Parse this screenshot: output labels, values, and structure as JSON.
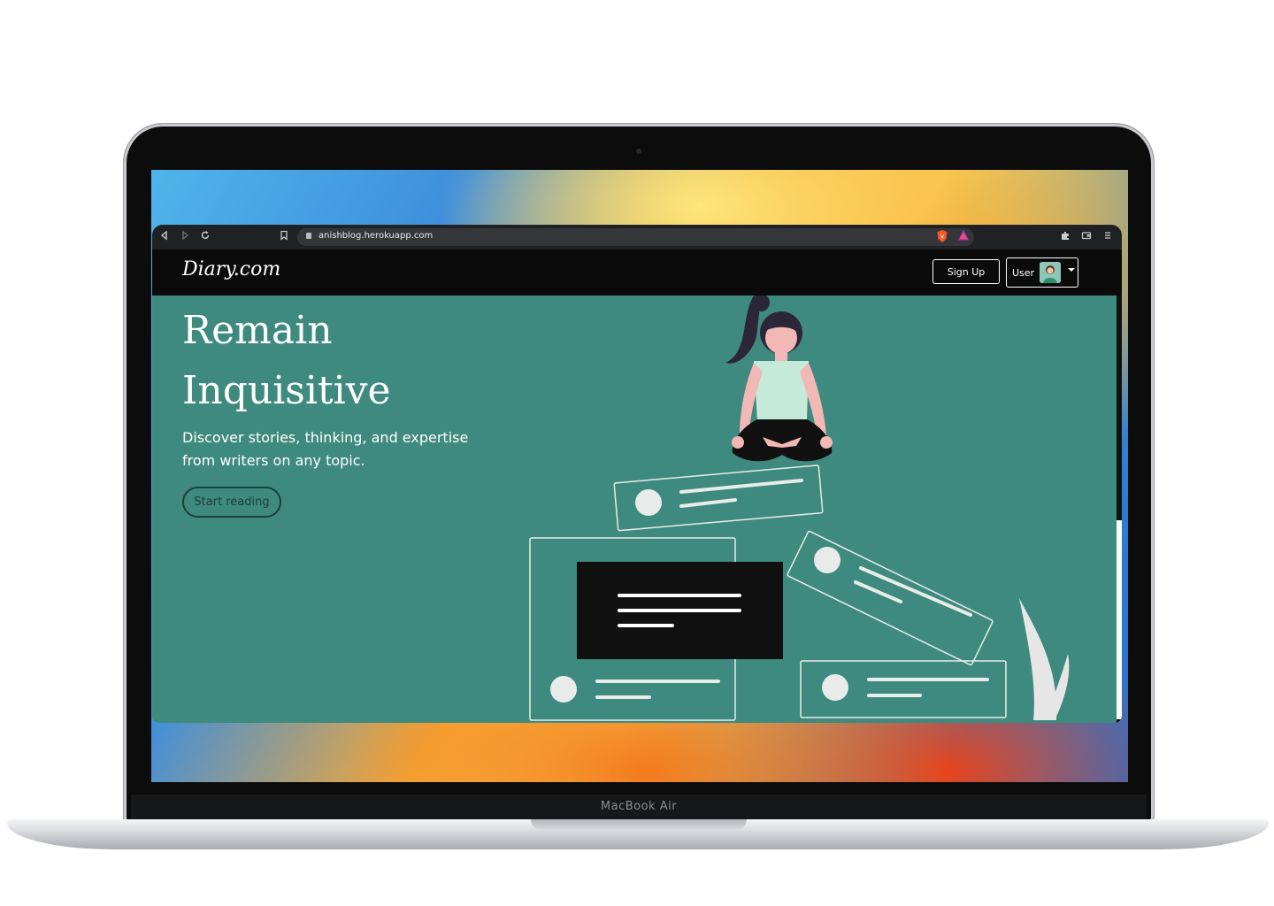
{
  "device": {
    "model_label": "MacBook Air"
  },
  "browser": {
    "url": "anishblog.herokuapp.com"
  },
  "site": {
    "brand": "Diary.com",
    "nav": {
      "signup_label": "Sign Up",
      "user_label": "User"
    },
    "hero": {
      "title_line1": "Remain",
      "title_line2": "Inquisitive",
      "subtitle": "Discover stories, thinking, and expertise from writers on any topic.",
      "cta_label": "Start reading"
    }
  },
  "colors": {
    "hero_bg": "#3e8a7e",
    "nav_bg": "#0b0b0b",
    "toolbar_bg": "#202124",
    "cta_border": "#1e3d38"
  },
  "icons": {
    "back": "back-arrow-icon",
    "forward": "forward-arrow-icon",
    "reload": "reload-icon",
    "bookmark": "bookmark-icon",
    "lock": "lock-icon",
    "brave": "brave-shield-icon",
    "rewards": "brave-rewards-icon",
    "extensions": "puzzle-icon",
    "wallet": "wallet-icon",
    "menu": "menu-icon"
  }
}
